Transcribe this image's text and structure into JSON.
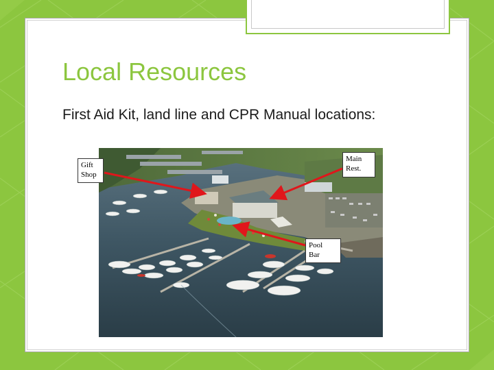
{
  "slide": {
    "title": "Local Resources",
    "subtitle": "First Aid Kit, land line and CPR Manual locations:"
  },
  "image": {
    "description_icon": "marina-aerial-photo"
  },
  "callouts": {
    "gift_shop": "Gift\nShop",
    "main_rest": "Main\nRest.",
    "pool_bar": "Pool\nBar"
  },
  "colors": {
    "accent": "#8cc63f",
    "arrow": "#e0161b"
  }
}
